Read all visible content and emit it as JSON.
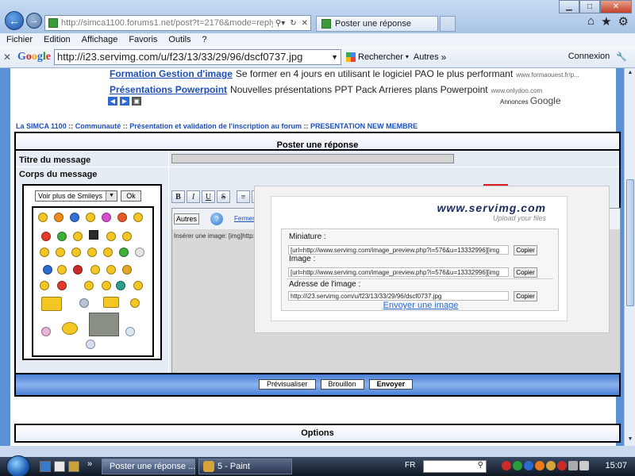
{
  "browser": {
    "url": "http://simca1100.forums1.net/post?t=2176&mode=reply",
    "url_domain": "forums1.net",
    "tab_active_title": "Poster une réponse",
    "menu": [
      "Fichier",
      "Edition",
      "Affichage",
      "Favoris",
      "Outils",
      "?"
    ]
  },
  "google_toolbar": {
    "logo": "Google",
    "search_value": "http://i23.servimg.com/u/f23/13/33/29/96/dscf0737.jpg",
    "search_button": "Rechercher",
    "more_button": "Autres",
    "connexion": "Connexion"
  },
  "ads": {
    "line1_link": "Formation Gestion d'image",
    "line1_text": "Se former en 4 jours en utilisant le logiciel PAO le plus performant",
    "line1_src": "www.formaouest.fr/p...",
    "line2_link": "Présentations Powerpoint",
    "line2_text": "Nouvelles présentations PPT Pack Arrieres plans Powerpoint",
    "line2_src": "www.onlydoo.com",
    "label": "Annonces",
    "label_brand": "Google"
  },
  "breadcrumb": {
    "items": [
      "La SIMCA 1100",
      "Communauté",
      "Présentation et validation de l'inscription au forum",
      "PRESENTATION NEW MEMBRE"
    ],
    "separator": "::"
  },
  "form": {
    "header": "Poster une réponse",
    "title_label": "Titre du message",
    "body_label": "Corps du message",
    "smileys_select": "Voir plus de Smileys",
    "smileys_ok": "Ok",
    "autres_button": "Autres",
    "fermer_link": "Fermer les B",
    "insert_text": "Insérer une image: [img]http://ima"
  },
  "popup": {
    "logo": "www.servimg.com",
    "tagline": "Upload your files",
    "miniature_label": "Miniature :",
    "miniature_value": "[url=http://www.servimg.com/image_preview.php?i=576&u=13332996][img",
    "image_label": "Image :",
    "image_value": "[url=http://www.servimg.com/image_preview.php?i=576&u=13332996][img",
    "address_label": "Adresse de l'image :",
    "address_value": "http://i23.servimg.com/u/f23/13/33/29/96/dscf0737.jpg",
    "copy_button": "Copier",
    "send_link": "Envoyer une image"
  },
  "submit": {
    "preview": "Prévisualiser",
    "draft": "Brouillon",
    "send": "Envoyer"
  },
  "options": {
    "label": "Options"
  },
  "taskbar": {
    "task1": "Poster une réponse ...",
    "task2": "5 - Paint",
    "lang": "FR",
    "time": "15:07"
  }
}
